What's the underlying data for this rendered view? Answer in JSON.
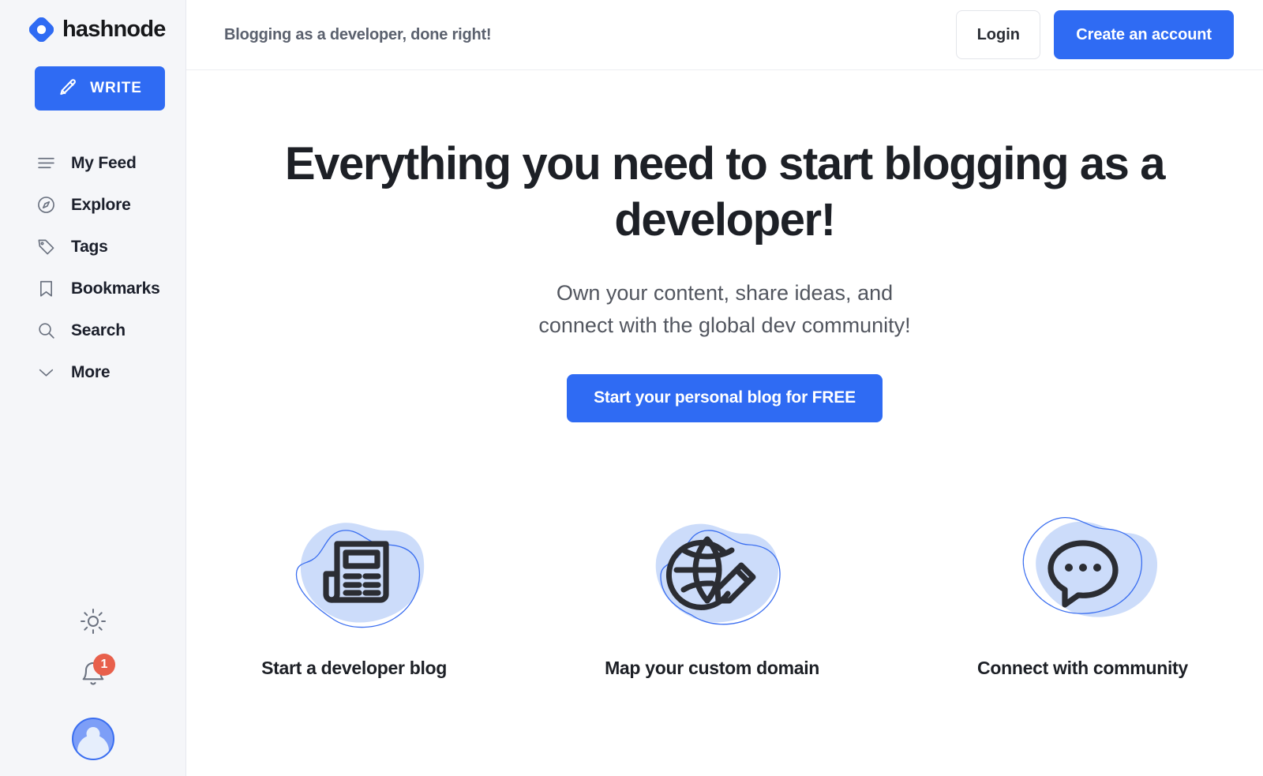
{
  "brand": {
    "name": "hashnode",
    "logo_icon": "hashnode-diamond-logo"
  },
  "sidebar": {
    "write_button": {
      "label": "WRITE",
      "icon": "pencil-icon"
    },
    "items": [
      {
        "label": "My Feed",
        "icon": "menu-lines-icon"
      },
      {
        "label": "Explore",
        "icon": "compass-icon"
      },
      {
        "label": "Tags",
        "icon": "tag-icon"
      },
      {
        "label": "Bookmarks",
        "icon": "bookmark-icon"
      },
      {
        "label": "Search",
        "icon": "search-icon"
      },
      {
        "label": "More",
        "icon": "chevron-down-icon"
      }
    ],
    "bottom": {
      "theme_toggle_icon": "sun-icon",
      "notifications_icon": "bell-icon",
      "notifications_count": "1",
      "avatar_icon": "user-avatar-icon"
    }
  },
  "header": {
    "tagline": "Blogging as a developer, done right!",
    "login_label": "Login",
    "create_account_label": "Create an account"
  },
  "hero": {
    "title": "Everything you need to start blogging as a developer!",
    "subtitle": "Own your content, share ideas, and\nconnect with the global dev community!",
    "cta_label": "Start your personal blog for FREE"
  },
  "features": [
    {
      "label": "Start a developer blog",
      "icon": "newspaper-icon"
    },
    {
      "label": "Map your custom domain",
      "icon": "globe-pencil-icon"
    },
    {
      "label": "Connect with community",
      "icon": "chat-bubble-icon"
    }
  ],
  "colors": {
    "accent_blue": "#2f6bf3",
    "badge_red": "#e8604c",
    "sidebar_bg": "#f5f6f9",
    "blob_fill": "#ccdcfa",
    "blob_stroke": "#3a6ef0",
    "icon_dark": "#2b2d33"
  }
}
